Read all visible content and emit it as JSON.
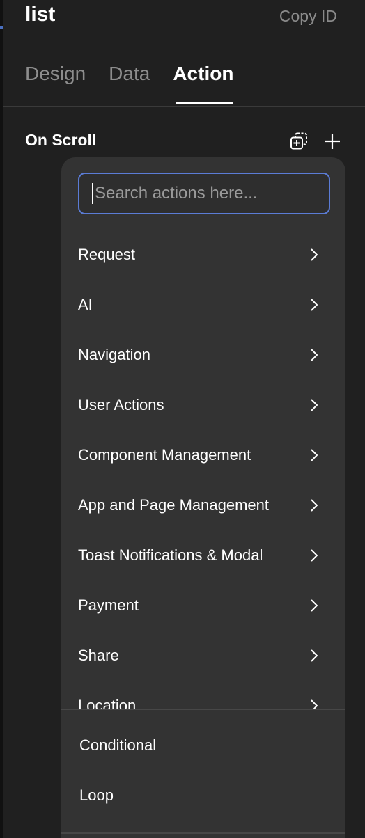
{
  "header": {
    "title": "list",
    "copy_id_label": "Copy ID"
  },
  "tabs": [
    {
      "label": "Design",
      "active": false
    },
    {
      "label": "Data",
      "active": false
    },
    {
      "label": "Action",
      "active": true
    }
  ],
  "event": {
    "label": "On Scroll",
    "icons": [
      "duplicate-icon",
      "plus-icon"
    ]
  },
  "search": {
    "placeholder": "Search actions here...",
    "value": ""
  },
  "menu": {
    "items": [
      {
        "label": "Request",
        "icon": "chevron-right-icon"
      },
      {
        "label": "AI",
        "icon": "chevron-right-icon"
      },
      {
        "label": "Navigation",
        "icon": "chevron-right-icon"
      },
      {
        "label": "User Actions",
        "icon": "chevron-right-icon"
      },
      {
        "label": "Component Management",
        "icon": "chevron-right-icon"
      },
      {
        "label": "App and Page Management",
        "icon": "chevron-right-icon"
      },
      {
        "label": "Toast Notifications & Modal",
        "icon": "chevron-right-icon"
      },
      {
        "label": "Payment",
        "icon": "chevron-right-icon"
      },
      {
        "label": "Share",
        "icon": "chevron-right-icon"
      },
      {
        "label": "Location",
        "icon": "chevron-right-icon"
      }
    ],
    "bottom_items": [
      {
        "label": "Conditional"
      },
      {
        "label": "Loop"
      }
    ]
  },
  "colors": {
    "accent": "#5b7cd6",
    "panel_bg": "#202020",
    "dropdown_bg": "#333333"
  }
}
